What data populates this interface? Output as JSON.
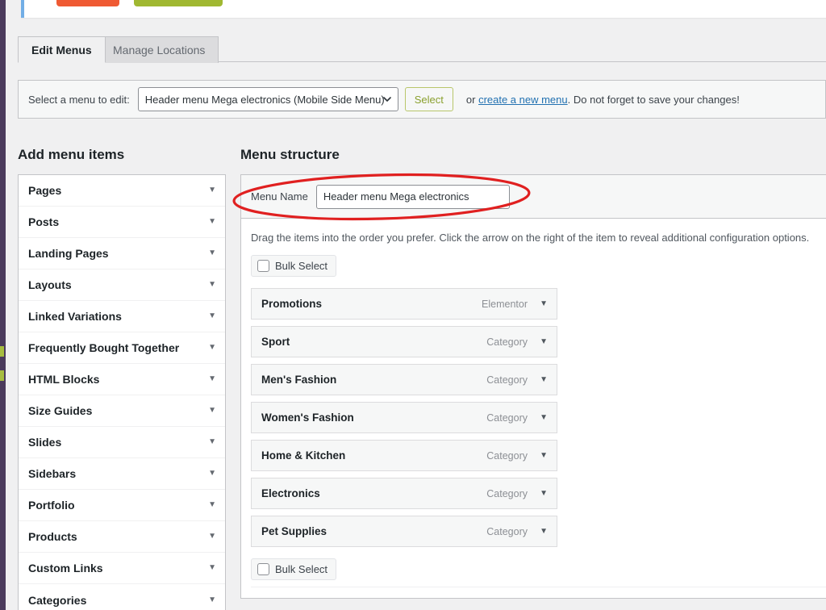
{
  "notice": {
    "button_primary_label": "",
    "button_secondary_label": "",
    "links_text": ""
  },
  "tabs": [
    {
      "label": "Edit Menus",
      "active": true
    },
    {
      "label": "Manage Locations",
      "active": false
    }
  ],
  "menu_select": {
    "label": "Select a menu to edit:",
    "selected_value": "Header menu Mega electronics (Mobile Side Menu)",
    "select_button_label": "Select",
    "tail_prefix": "or ",
    "tail_link": "create a new menu",
    "tail_suffix": ". Do not forget to save your changes!"
  },
  "headings": {
    "add_menu_items": "Add menu items",
    "menu_structure": "Menu structure"
  },
  "add_menu_items": [
    {
      "label": "Pages"
    },
    {
      "label": "Posts"
    },
    {
      "label": "Landing Pages"
    },
    {
      "label": "Layouts"
    },
    {
      "label": "Linked Variations"
    },
    {
      "label": "Frequently Bought Together"
    },
    {
      "label": "HTML Blocks"
    },
    {
      "label": "Size Guides"
    },
    {
      "label": "Slides"
    },
    {
      "label": "Sidebars"
    },
    {
      "label": "Portfolio"
    },
    {
      "label": "Products"
    },
    {
      "label": "Custom Links"
    },
    {
      "label": "Categories"
    }
  ],
  "menu_structure": {
    "name_label": "Menu Name",
    "name_value": "Header menu Mega electronics",
    "name_placeholder": "Menu Name",
    "drag_hint": "Drag the items into the order you prefer. Click the arrow on the right of the item to reveal additional configuration options.",
    "bulk_select_label": "Bulk Select",
    "items": [
      {
        "title": "Promotions",
        "type": "Elementor"
      },
      {
        "title": "Sport",
        "type": "Category"
      },
      {
        "title": "Men's Fashion",
        "type": "Category"
      },
      {
        "title": "Women's Fashion",
        "type": "Category"
      },
      {
        "title": "Home & Kitchen",
        "type": "Category"
      },
      {
        "title": "Electronics",
        "type": "Category"
      },
      {
        "title": "Pet Supplies",
        "type": "Category"
      }
    ]
  },
  "annotation": {
    "shape": "ellipse",
    "color": "#e02020",
    "target": "menu-name-row"
  },
  "colors": {
    "admin_rail": "#4b3b5c",
    "admin_rail_accent": "#a7bd40",
    "page_background": "#f0f0f1",
    "panel_background": "#ffffff",
    "panel_border": "#c3c4c7",
    "link": "#2271b1",
    "notice_accent": "#72aee6",
    "notice_button_orange": "#ef5a33",
    "notice_button_green": "#a0b832",
    "annotation_red": "#e02020"
  },
  "icons": {
    "accordion_caret": "▼",
    "menu_item_caret": "▼",
    "select_caret": "chevron-down-icon"
  }
}
